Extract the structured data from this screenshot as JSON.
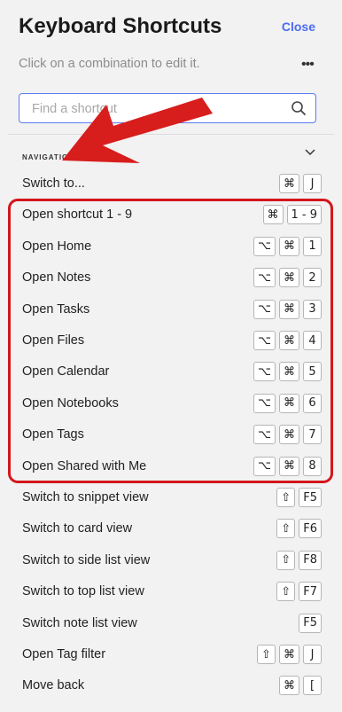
{
  "header": {
    "title": "Keyboard Shortcuts",
    "close_label": "Close"
  },
  "subtitle": "Click on a combination to edit it.",
  "more_icon": "•••",
  "search": {
    "placeholder": "Find a shortcut",
    "value": ""
  },
  "section": {
    "label": "NAVIGATION"
  },
  "accent_color": "#4b6cf0",
  "highlight_color": "#d3161c",
  "rows": [
    {
      "label": "Switch to...",
      "keys": [
        "⌘",
        "J"
      ]
    },
    {
      "label": "Open shortcut 1 - 9",
      "keys": [
        "⌘",
        "1 - 9"
      ]
    },
    {
      "label": "Open Home",
      "keys": [
        "⌥",
        "⌘",
        "1"
      ]
    },
    {
      "label": "Open Notes",
      "keys": [
        "⌥",
        "⌘",
        "2"
      ]
    },
    {
      "label": "Open Tasks",
      "keys": [
        "⌥",
        "⌘",
        "3"
      ]
    },
    {
      "label": "Open Files",
      "keys": [
        "⌥",
        "⌘",
        "4"
      ]
    },
    {
      "label": "Open Calendar",
      "keys": [
        "⌥",
        "⌘",
        "5"
      ]
    },
    {
      "label": "Open Notebooks",
      "keys": [
        "⌥",
        "⌘",
        "6"
      ]
    },
    {
      "label": "Open Tags",
      "keys": [
        "⌥",
        "⌘",
        "7"
      ]
    },
    {
      "label": "Open Shared with Me",
      "keys": [
        "⌥",
        "⌘",
        "8"
      ]
    },
    {
      "label": "Switch to snippet view",
      "keys": [
        "⇧",
        "F5"
      ]
    },
    {
      "label": "Switch to card view",
      "keys": [
        "⇧",
        "F6"
      ]
    },
    {
      "label": "Switch to side list view",
      "keys": [
        "⇧",
        "F8"
      ]
    },
    {
      "label": "Switch to top list view",
      "keys": [
        "⇧",
        "F7"
      ]
    },
    {
      "label": "Switch note list view",
      "keys": [
        "F5"
      ]
    },
    {
      "label": "Open Tag filter",
      "keys": [
        "⇧",
        "⌘",
        "J"
      ]
    },
    {
      "label": "Move back",
      "keys": [
        "⌘",
        "["
      ]
    }
  ]
}
